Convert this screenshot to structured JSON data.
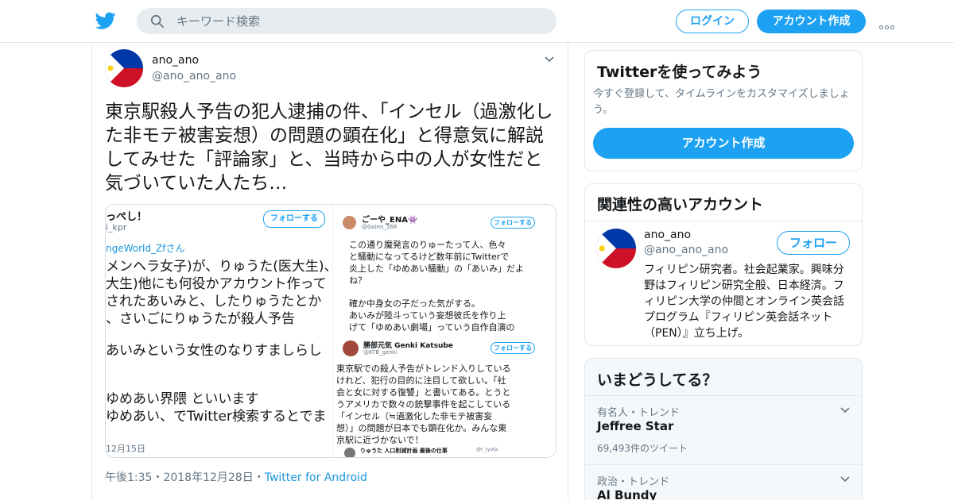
{
  "header": {
    "search_placeholder": "キーワード検索",
    "login_label": "ログイン",
    "signup_label": "アカウント作成"
  },
  "tweet": {
    "name": "ano_ano",
    "handle": "@ano_ano_ano",
    "text": "東京駅殺人予告の犯人逮捕の件、「インセル（過激化した非モテ被害妄想）の問題の顕在化」と得意気に解説してみせた「評論家」と、当時から中の人が女性だと気づいていた人たち…",
    "time": "午後1:35",
    "date": "2018年12月28日",
    "separator": "・",
    "client": "Twitter for Android"
  },
  "media": {
    "left": {
      "name": "っぺし！",
      "handle": "i_kpr",
      "follow": "フォローする",
      "reply_to": "ngeWorld_Zfさん",
      "lines": [
        "メンヘラ女子)が、りゅうた(医大生)、",
        "大生)他にも何役かアカウント作って",
        "されたあいみと、したりゅうたとか",
        "、さいごにりゅうたが殺人予告",
        "",
        "あいみという女性のなりすましらし",
        "",
        "",
        "ゆめあい界隈 といいます",
        "ゆめあい、でTwitter検索するとでま"
      ],
      "date": "12月15日"
    },
    "right": {
      "t1": {
        "name": "ごーや_ENA👾",
        "handle": "@Goien_168",
        "follow": "フォローする",
        "lines": [
          "この通り魔発言のりゅーたって人、色々",
          "と騒動になってるけど数年前にTwitterで",
          "炎上した「ゆめあい騒動」の「あいみ」だよ",
          "ね？",
          "",
          "確か中身女の子だった気がする。",
          "あいみが陸斗っていう妄想彼氏を作り上",
          "げて「ゆめあい劇場」っていう自作自演の"
        ]
      },
      "t2": {
        "name": "勝部元気 Genki Katsube",
        "handle": "@KTB_genki",
        "follow": "フォローする",
        "lines": [
          "東京駅での殺人予告がトレンド入りしている",
          "けれど、犯行の目的に注目して欲しい。「社",
          "会と女に対する復讐」と書いてある。とうと",
          "うアメリカで数々の銃撃事件を起こしている",
          "「インセル（≒過激化した非モテ被害妄",
          "想）」の問題が日本でも顕在化か。みんな東",
          "京駅に近づかないで！"
        ]
      },
      "t3": {
        "name": "りゅうた 人口削減計画 最後の仕事",
        "handle": "@r_ryota"
      }
    }
  },
  "sidebar": {
    "signup_card": {
      "title": "Twitterを使ってみよう",
      "subtitle": "今すぐ登録して、タイムラインをカスタマイズしましょう。",
      "button": "アカウント作成"
    },
    "related": {
      "title": "関連性の高いアカウント",
      "name": "ano_ano",
      "handle": "@ano_ano_ano",
      "follow": "フォロー",
      "bio": "フィリピン研究者。社会起業家。興味分野はフィリピン研究全般、日本経済。フィリピン大学の仲間とオンライン英会話プログラム『フィリピン英会話ネット（PEN）』立ち上げ。"
    },
    "trends": {
      "title": "いまどうしてる？",
      "items": [
        {
          "category": "有名人・トレンド",
          "name": "Jeffree Star",
          "count": "69,493件のツイート"
        },
        {
          "category": "政治・トレンド",
          "name": "Al Bundy",
          "count": ""
        }
      ]
    }
  },
  "colors": {
    "accent": "#1da1f2",
    "flag_blue": "#0038a8",
    "flag_red": "#ce1126",
    "flag_yellow": "#fcd116"
  }
}
